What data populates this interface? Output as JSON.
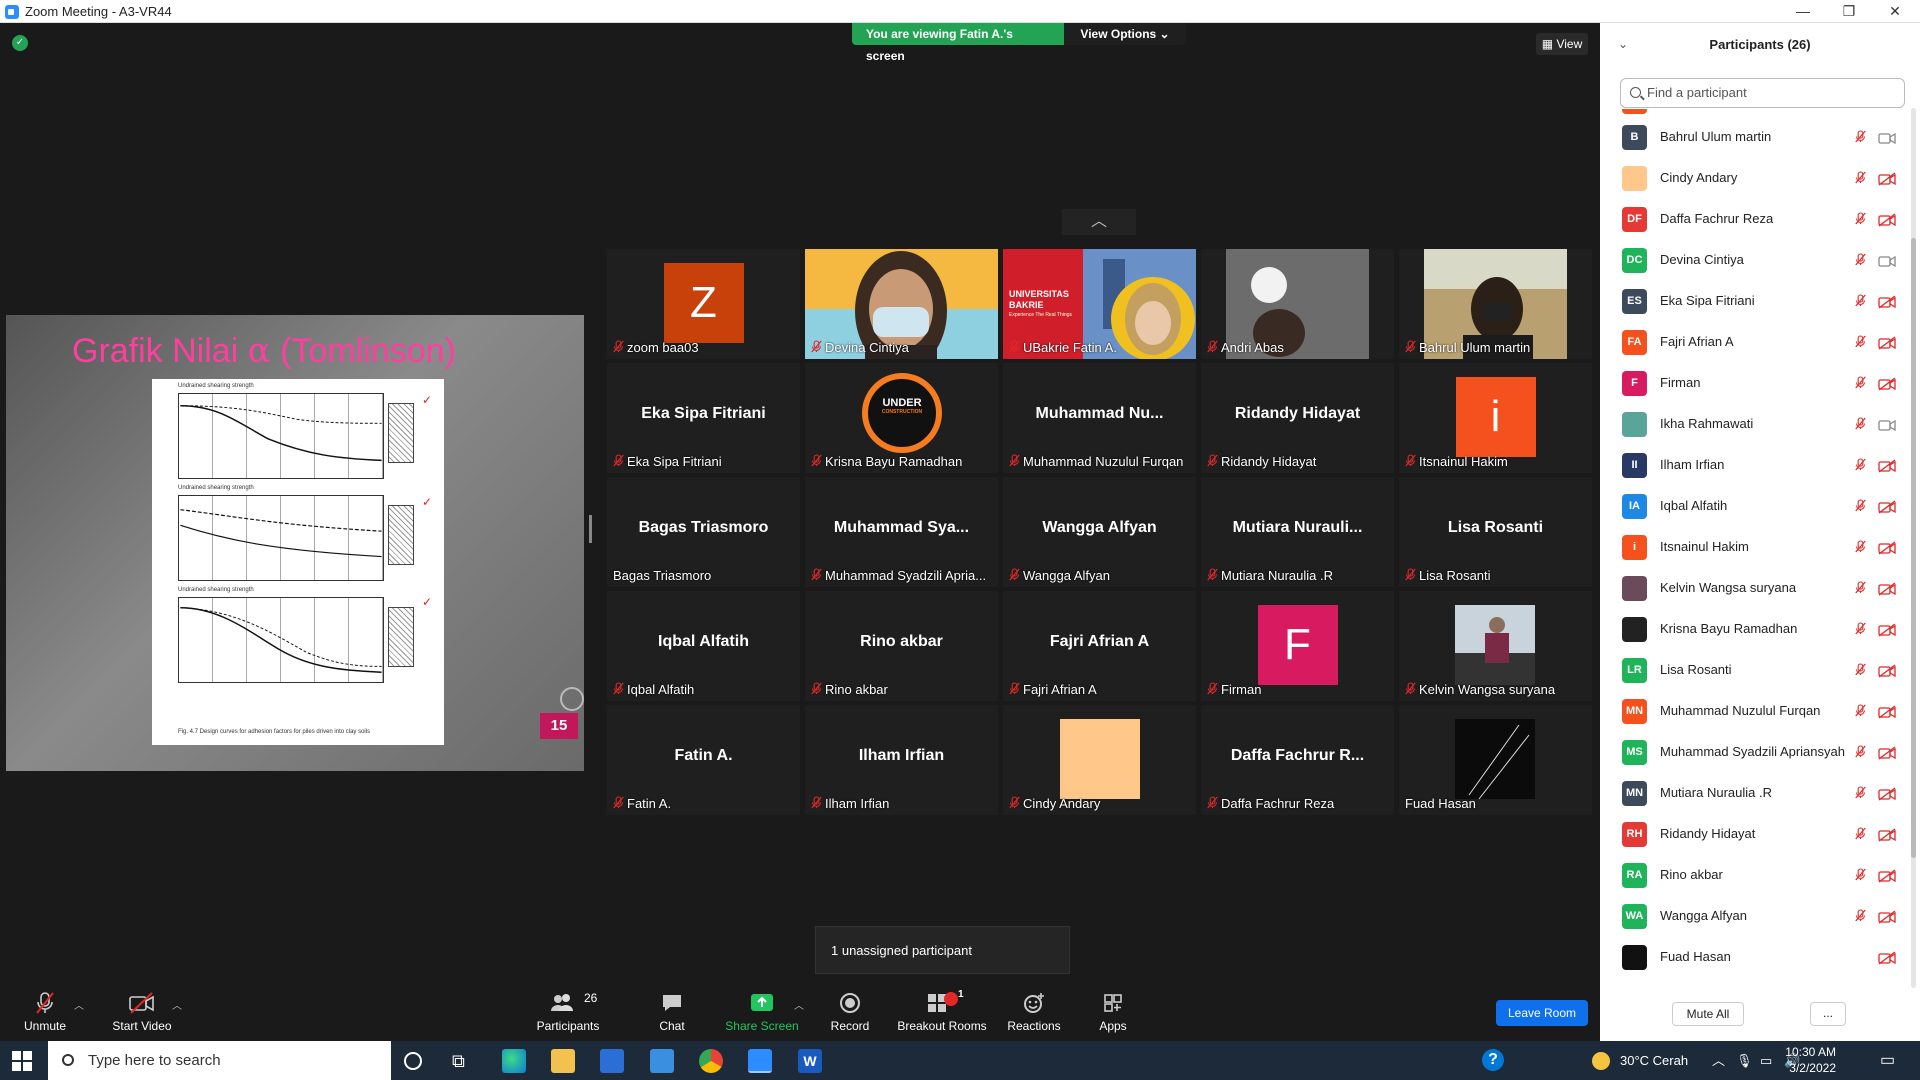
{
  "window": {
    "title": "Zoom Meeting - A3-VR44"
  },
  "meeting": {
    "viewing_banner": "You are viewing Fatin A.'s screen",
    "view_options_label": "View Options",
    "view_button_label": "View"
  },
  "slide": {
    "title_prefix": "Grafik Nilai ",
    "title_alpha": "α",
    "title_suffix": " (Tomlinson)",
    "page_number": "15",
    "figure_caption": "Fig. 4.7   Design curves for adhesion factors for piles driven into clay soils",
    "axis_caption": "Undrained shearing strength",
    "ticks": [
      "✓",
      "✓",
      "✓"
    ]
  },
  "gallery": {
    "tiles": [
      {
        "name": "zoom baa03",
        "muted": true,
        "avatar_text": "Z",
        "avatar_color": "#c8400a",
        "kind": "avatar"
      },
      {
        "name": "Devina Cintiya",
        "muted": true,
        "kind": "video",
        "scene": "girl"
      },
      {
        "name": "UBakrie Fatin A.",
        "muted": true,
        "kind": "video",
        "scene": "ubakrie",
        "active": true,
        "banner_line1": "UNIVERSITAS",
        "banner_line2": "BAKRIE",
        "banner_line3": "Experience The Real Things"
      },
      {
        "name": "Andri Abas",
        "muted": true,
        "kind": "video",
        "scene": "dark"
      },
      {
        "name": "Bahrul Ulum martin",
        "muted": true,
        "kind": "video",
        "scene": "outdoor"
      },
      {
        "name": "Eka Sipa Fitriani",
        "display": "Eka Sipa Fitriani",
        "muted": true,
        "kind": "name"
      },
      {
        "name": "Krisna Bayu Ramadhan",
        "muted": true,
        "kind": "logo",
        "logo_line1": "UNDER",
        "logo_line2": "CONSTRUCTION"
      },
      {
        "name": "Muhammad Nuzulul Furqan",
        "display": "Muhammad  Nu...",
        "muted": true,
        "kind": "name"
      },
      {
        "name": "Ridandy Hidayat",
        "display": "Ridandy Hidayat",
        "muted": true,
        "kind": "name"
      },
      {
        "name": "Itsnainul Hakim",
        "muted": true,
        "avatar_text": "i",
        "avatar_color": "#f4511e",
        "kind": "avatar"
      },
      {
        "name": "Bagas Triasmoro",
        "display": "Bagas Triasmoro",
        "muted": false,
        "kind": "name"
      },
      {
        "name": "Muhammad Syadzili Apria...",
        "display": "Muhammad  Sya...",
        "muted": true,
        "kind": "name"
      },
      {
        "name": "Wangga Alfyan",
        "display": "Wangga Alfyan",
        "muted": true,
        "kind": "name"
      },
      {
        "name": "Mutiara Nuraulia .R",
        "display": "Mutiara  Nurauli...",
        "muted": true,
        "kind": "name"
      },
      {
        "name": "Lisa Rosanti",
        "display": "Lisa Rosanti",
        "muted": true,
        "kind": "name"
      },
      {
        "name": "Iqbal Alfatih",
        "display": "Iqbal Alfatih",
        "muted": true,
        "kind": "name"
      },
      {
        "name": "Rino akbar",
        "display": "Rino akbar",
        "muted": true,
        "kind": "name"
      },
      {
        "name": "Fajri Afrian A",
        "display": "Fajri Afrian A",
        "muted": true,
        "kind": "name"
      },
      {
        "name": "Firman",
        "muted": true,
        "avatar_text": "F",
        "avatar_color": "#d81b60",
        "kind": "avatar"
      },
      {
        "name": "Kelvin Wangsa suryana",
        "muted": true,
        "kind": "photo"
      },
      {
        "name": "Fatin A.",
        "display": "Fatin A.",
        "muted": true,
        "kind": "name"
      },
      {
        "name": "Ilham Irfian",
        "display": "Ilham Irfian",
        "muted": true,
        "kind": "name"
      },
      {
        "name": "Cindy Andary",
        "muted": true,
        "avatar_text": "",
        "avatar_color": "#ffc78a",
        "kind": "avatar"
      },
      {
        "name": "Daffa Fachrur Reza",
        "display": "Daffa Fachrur R...",
        "muted": true,
        "kind": "name"
      },
      {
        "name": "Fuad Hasan",
        "muted": false,
        "kind": "dark-photo"
      }
    ]
  },
  "unassigned_popover": "1 unassigned participant",
  "toolbar": {
    "unmute": "Unmute",
    "start_video": "Start Video",
    "participants": "Participants",
    "participants_count": "26",
    "chat": "Chat",
    "share_screen": "Share Screen",
    "record": "Record",
    "breakout_rooms": "Breakout Rooms",
    "breakout_badge": "1",
    "reactions": "Reactions",
    "apps": "Apps",
    "leave_room": "Leave Room"
  },
  "participants_panel": {
    "title": "Participants (26)",
    "search_placeholder": "Find a participant",
    "mute_all": "Mute All",
    "more": "...",
    "list": [
      {
        "name": "Bahrul Ulum martin",
        "initials": "B",
        "color": "#3d4a5c",
        "mic_muted": true,
        "cam": "off-grey"
      },
      {
        "name": "Cindy Andary",
        "initials": "",
        "color": "#ffc78a",
        "mic_muted": true,
        "cam": "off"
      },
      {
        "name": "Daffa Fachrur Reza",
        "initials": "DF",
        "color": "#e53935",
        "mic_muted": true,
        "cam": "off"
      },
      {
        "name": "Devina Cintiya",
        "initials": "DC",
        "color": "#1fb45a",
        "mic_muted": true,
        "cam": "on"
      },
      {
        "name": "Eka Sipa Fitriani",
        "initials": "ES",
        "color": "#3d4a5c",
        "mic_muted": true,
        "cam": "off"
      },
      {
        "name": "Fajri Afrian A",
        "initials": "FA",
        "color": "#f4511e",
        "mic_muted": true,
        "cam": "off"
      },
      {
        "name": "Firman",
        "initials": "F",
        "color": "#d81b60",
        "mic_muted": true,
        "cam": "off"
      },
      {
        "name": "Ikha Rahmawati",
        "initials": "",
        "color": "#5aa59a",
        "mic_muted": true,
        "cam": "on"
      },
      {
        "name": "Ilham Irfian",
        "initials": "II",
        "color": "#283a63",
        "mic_muted": true,
        "cam": "off"
      },
      {
        "name": "Iqbal Alfatih",
        "initials": "IA",
        "color": "#1e88e5",
        "mic_muted": true,
        "cam": "off"
      },
      {
        "name": "Itsnainul Hakim",
        "initials": "i",
        "color": "#f4511e",
        "mic_muted": true,
        "cam": "off"
      },
      {
        "name": "Kelvin Wangsa suryana",
        "initials": "",
        "color": "#6b4b5a",
        "mic_muted": true,
        "cam": "off"
      },
      {
        "name": "Krisna Bayu Ramadhan",
        "initials": "",
        "color": "#222222",
        "mic_muted": true,
        "cam": "off"
      },
      {
        "name": "Lisa Rosanti",
        "initials": "LR",
        "color": "#1fb45a",
        "mic_muted": true,
        "cam": "off"
      },
      {
        "name": "Muhammad Nuzulul Furqan",
        "initials": "MN",
        "color": "#f4511e",
        "mic_muted": true,
        "cam": "off"
      },
      {
        "name": "Muhammad Syadzili Apriansyah",
        "initials": "MS",
        "color": "#1fb45a",
        "mic_muted": true,
        "cam": "off"
      },
      {
        "name": "Mutiara Nuraulia .R",
        "initials": "MN",
        "color": "#3d4a5c",
        "mic_muted": true,
        "cam": "off"
      },
      {
        "name": "Ridandy Hidayat",
        "initials": "RH",
        "color": "#e53935",
        "mic_muted": true,
        "cam": "off"
      },
      {
        "name": "Rino akbar",
        "initials": "RA",
        "color": "#1fb45a",
        "mic_muted": true,
        "cam": "off"
      },
      {
        "name": "Wangga Alfyan",
        "initials": "WA",
        "color": "#1fb45a",
        "mic_muted": true,
        "cam": "off"
      },
      {
        "name": "Fuad Hasan",
        "initials": "",
        "color": "#111111",
        "mic_muted": false,
        "cam": "off"
      }
    ]
  },
  "taskbar": {
    "search_placeholder": "Type here to search",
    "weather": "30°C  Cerah",
    "time": "10:30 AM",
    "date": "3/2/2022"
  },
  "colors": {
    "accent": "#0e71eb",
    "banner_green": "#23a455",
    "mute_red": "#e02828"
  }
}
